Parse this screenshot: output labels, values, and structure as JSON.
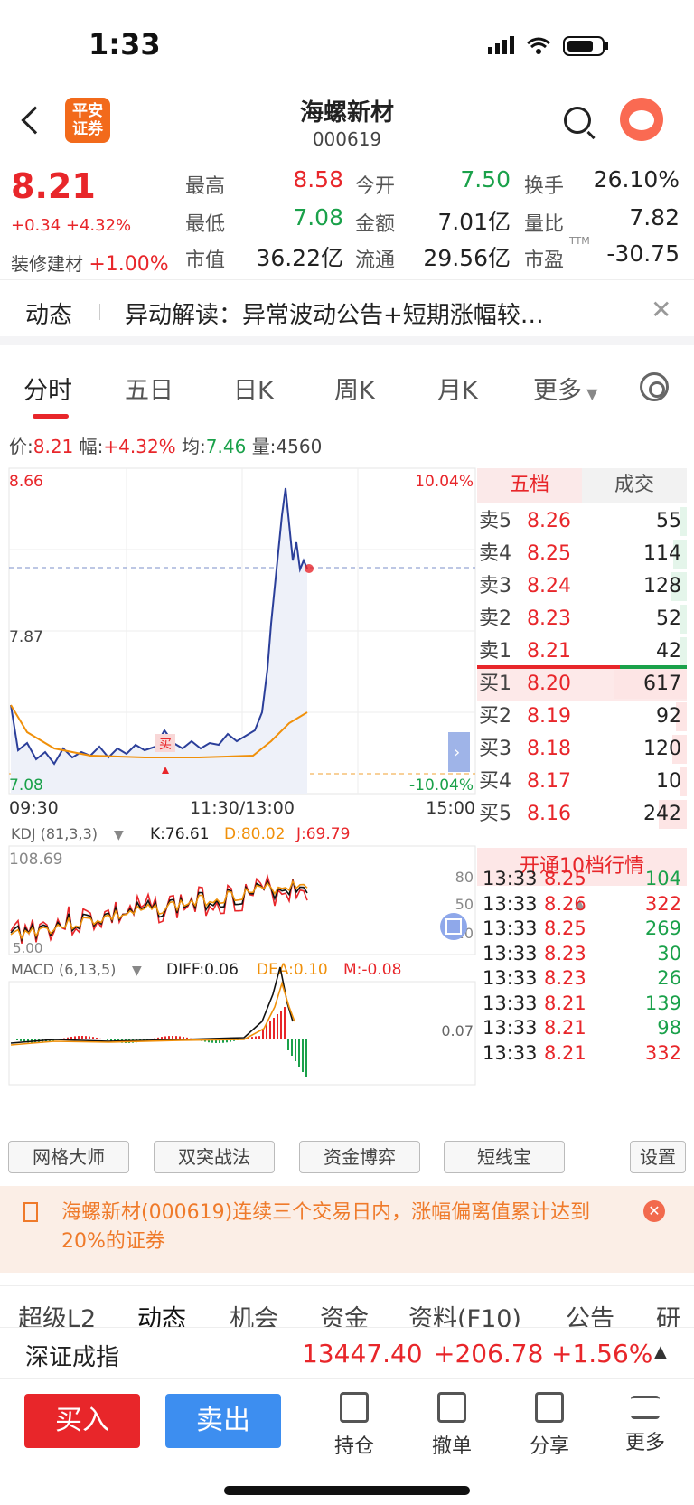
{
  "status": {
    "time": "1:33"
  },
  "header": {
    "title": "海螺新材",
    "code": "000619",
    "logo_text": "平安\n证券"
  },
  "quote": {
    "price": "8.21",
    "change": "+0.34 +4.32%",
    "sector_name": "装修建材",
    "sector_change": "+1.00%",
    "fields": [
      {
        "label": "最高",
        "value": "8.58",
        "color": "red"
      },
      {
        "label": "今开",
        "value": "7.50",
        "color": "green"
      },
      {
        "label": "换手",
        "value": "26.10%",
        "color": "black"
      },
      {
        "label": "最低",
        "value": "7.08",
        "color": "green"
      },
      {
        "label": "金额",
        "value": "7.01亿",
        "color": "black"
      },
      {
        "label": "量比",
        "value": "7.82",
        "color": "black"
      },
      {
        "label": "市值",
        "value": "36.22亿",
        "color": "black"
      },
      {
        "label": "流通",
        "value": "29.56亿",
        "color": "black"
      },
      {
        "label": "市盈",
        "value": "-30.75",
        "color": "black",
        "sup": "TTM"
      }
    ]
  },
  "news": {
    "tag": "动态",
    "text": "异动解读：异常波动公告+短期涨幅较…"
  },
  "tabs": [
    "分时",
    "五日",
    "日K",
    "周K",
    "月K",
    "更多"
  ],
  "info": {
    "price_label": "价:",
    "price": "8.21",
    "pct_label": "幅:",
    "pct": "+4.32%",
    "avg_label": "均:",
    "avg": "7.46",
    "vol_label": "量:",
    "vol": "4560"
  },
  "chart": {
    "y_high": "8.66",
    "y_mid": "7.87",
    "y_low": "7.08",
    "pct_high": "10.04%",
    "pct_low": "-10.04%",
    "x_start": "09:30",
    "x_mid": "11:30/13:00",
    "x_end": "15:00",
    "buy_marker": "买",
    "kdj_title": "KDJ (81,3,3)",
    "kdj_k": "K:76.61",
    "kdj_d": "D:80.02",
    "kdj_j": "J:69.79",
    "kdj_top": "108.69",
    "kdj_80": "80",
    "kdj_50": "50",
    "kdj_20": "20",
    "kdj_bottom": "5.00",
    "macd_title": "MACD (6,13,5)",
    "macd_diff": "DIFF:0.06",
    "macd_dea": "DEA:0.10",
    "macd_m": "M:-0.08",
    "macd_val": "0.07"
  },
  "orderbook": {
    "tab_five": "五档",
    "tab_trades": "成交",
    "asks": [
      {
        "label": "卖5",
        "price": "8.26",
        "vol": "55"
      },
      {
        "label": "卖4",
        "price": "8.25",
        "vol": "114"
      },
      {
        "label": "卖3",
        "price": "8.24",
        "vol": "128"
      },
      {
        "label": "卖2",
        "price": "8.23",
        "vol": "52"
      },
      {
        "label": "卖1",
        "price": "8.21",
        "vol": "42"
      }
    ],
    "bids": [
      {
        "label": "买1",
        "price": "8.20",
        "vol": "617"
      },
      {
        "label": "买2",
        "price": "8.19",
        "vol": "92"
      },
      {
        "label": "买3",
        "price": "8.18",
        "vol": "120"
      },
      {
        "label": "买4",
        "price": "8.17",
        "vol": "10"
      },
      {
        "label": "买5",
        "price": "8.16",
        "vol": "242"
      }
    ],
    "upgrade": "开通10档行情",
    "ticks": [
      {
        "time": "13:33",
        "price": "8.25",
        "vol": "104",
        "color": "green"
      },
      {
        "time": "13:33",
        "price": "8.26",
        "vol": "322",
        "color": "red"
      },
      {
        "time": "13:33",
        "price": "8.25",
        "vol": "269",
        "color": "green"
      },
      {
        "time": "13:33",
        "price": "8.23",
        "vol": "30",
        "color": "green"
      },
      {
        "time": "13:33",
        "price": "8.23",
        "vol": "26",
        "color": "green"
      },
      {
        "time": "13:33",
        "price": "8.21",
        "vol": "139",
        "color": "green"
      },
      {
        "time": "13:33",
        "price": "8.21",
        "vol": "98",
        "color": "green"
      },
      {
        "time": "13:33",
        "price": "8.21",
        "vol": "332",
        "color": "red"
      }
    ]
  },
  "strategies": [
    "网格大师",
    "双突战法",
    "资金博弈",
    "短线宝",
    "设置"
  ],
  "notice": "海螺新材(000619)连续三个交易日内，涨幅偏离值累计达到20%的证券",
  "bottom_tabs": [
    "超级L2",
    "动态",
    "机会",
    "资金",
    "资料(F10)",
    "公告",
    "研报"
  ],
  "index": {
    "name": "深证成指",
    "value": "13447.40",
    "change": "+206.78",
    "pct": "+1.56%"
  },
  "actions": {
    "buy": "买入",
    "sell": "卖出",
    "items": [
      "持仓",
      "撤单",
      "分享",
      "更多"
    ]
  },
  "colors": {
    "up": "#e8262a",
    "down": "#1aa14a",
    "sell_btn": "#3d8ef0",
    "accent": "#f26a1b"
  }
}
